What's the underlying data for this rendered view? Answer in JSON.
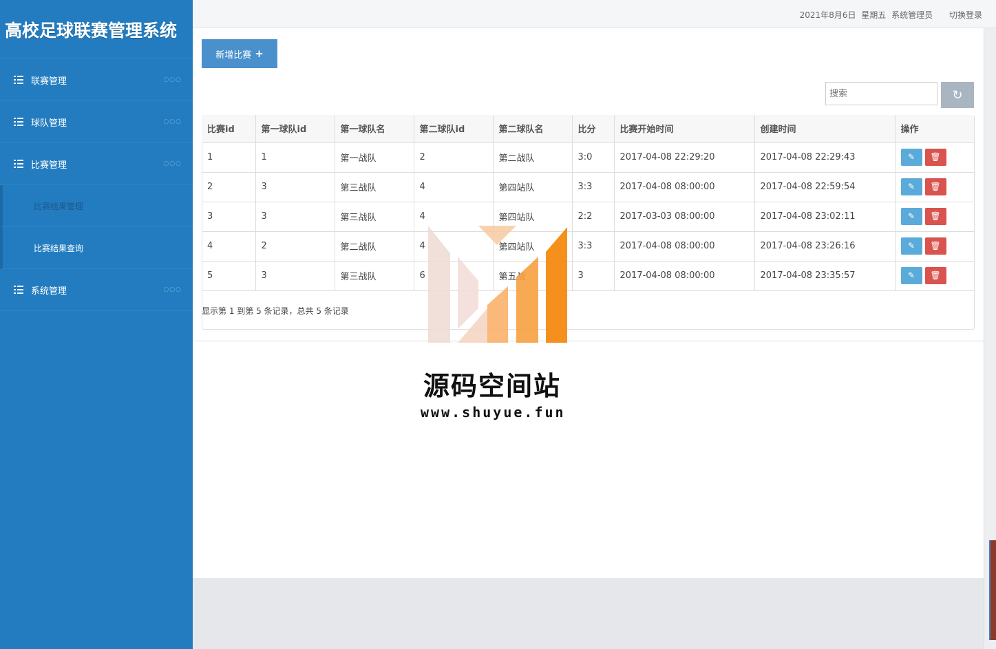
{
  "app": {
    "title": "高校足球联赛管理系统"
  },
  "sidebar": {
    "items": [
      {
        "label": "联赛管理",
        "dots": "○○○"
      },
      {
        "label": "球队管理",
        "dots": "○○○"
      },
      {
        "label": "比赛管理",
        "dots": "○○○"
      },
      {
        "label": "比赛结果管理"
      },
      {
        "label": "比赛结果查询"
      },
      {
        "label": "系统管理",
        "dots": "○○○"
      }
    ]
  },
  "topbar": {
    "date": "2021年8月6日",
    "weekday": "星期五",
    "user": "系统管理员",
    "switch_label": "切换登录"
  },
  "toolbar": {
    "add_label": "新增比赛",
    "add_icon": "+",
    "search_placeholder": "搜索",
    "refresh_icon": "↻"
  },
  "table": {
    "headers": [
      "比赛id",
      "第一球队id",
      "第一球队名",
      "第二球队id",
      "第二球队名",
      "比分",
      "比赛开始时间",
      "创建时间",
      "操作"
    ],
    "rows": [
      [
        "1",
        "1",
        "第一战队",
        "2",
        "第二战队",
        "3:0",
        "2017-04-08 22:29:20",
        "2017-04-08 22:29:43"
      ],
      [
        "2",
        "3",
        "第三战队",
        "4",
        "第四站队",
        "3:3",
        "2017-04-08 08:00:00",
        "2017-04-08 22:59:54"
      ],
      [
        "3",
        "3",
        "第三战队",
        "4",
        "第四站队",
        "2:2",
        "2017-03-03 08:00:00",
        "2017-04-08 23:02:11"
      ],
      [
        "4",
        "2",
        "第二战队",
        "4",
        "第四站队",
        "3:3",
        "2017-04-08 08:00:00",
        "2017-04-08 23:26:16"
      ],
      [
        "5",
        "3",
        "第三战队",
        "6",
        "第五战",
        "3",
        "2017-04-08 08:00:00",
        "2017-04-08 23:35:57"
      ]
    ],
    "edit_icon": "✎",
    "delete_icon": "🗑"
  },
  "pager": {
    "summary": "显示第 1 到第 5 条记录，总共 5 条记录"
  },
  "watermark": {
    "title": "源码空间站",
    "url": "www.shuyue.fun"
  },
  "colors": {
    "sidebar": "#237cbf",
    "primary_button": "#4a90cc",
    "edit_button": "#5aabd9",
    "delete_button": "#d9534f"
  }
}
